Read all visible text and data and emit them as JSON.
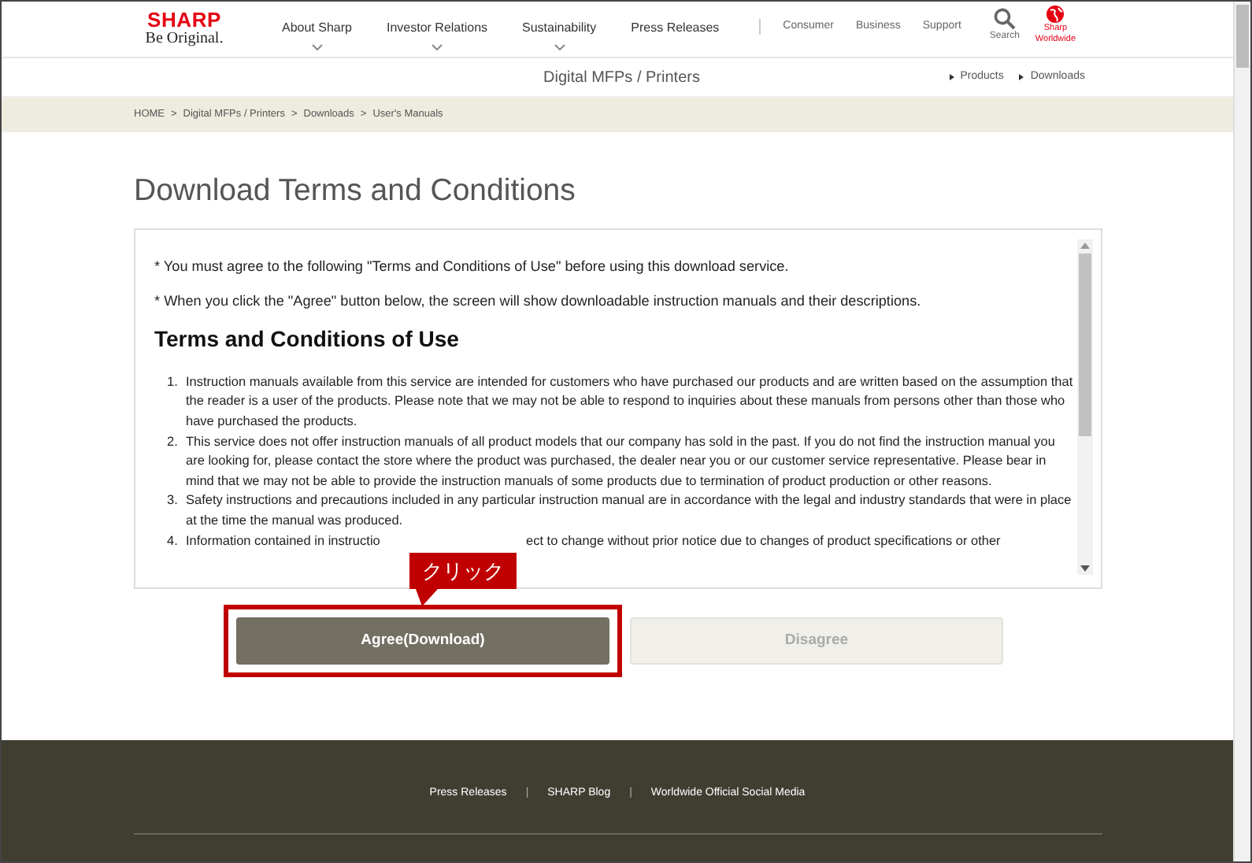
{
  "header": {
    "logo": "SHARP",
    "tagline": "Be Original.",
    "nav": [
      {
        "label": "About Sharp",
        "dropdown": true
      },
      {
        "label": "Investor Relations",
        "dropdown": true
      },
      {
        "label": "Sustainability",
        "dropdown": true
      },
      {
        "label": "Press Releases",
        "dropdown": false
      }
    ],
    "utility_links": [
      "Consumer",
      "Business",
      "Support"
    ],
    "search": "Search",
    "worldwide": [
      "Sharp",
      "Worldwide"
    ]
  },
  "subheader": {
    "title": "Digital MFPs / Printers",
    "links": [
      "Products",
      "Downloads"
    ]
  },
  "breadcrumb": [
    "HOME",
    "Digital MFPs / Printers",
    "Downloads",
    "User's Manuals"
  ],
  "breadcrumb_separator": ">",
  "page_title": "Download Terms and Conditions",
  "terms": {
    "notes": [
      "* You must agree to the following \"Terms and Conditions of Use\" before using this download service.",
      "* When you click the \"Agree\" button below, the screen will show downloadable instruction manuals and their descriptions."
    ],
    "heading": "Terms and Conditions of Use",
    "items": [
      {
        "number": "1.",
        "parts": [
          "Instruction manuals available from this service are intended for customers who have purchased our products and are written based on the assumption that the reader is a user of the products. Please note that we may not be able to respond to inquiries about these manuals from persons other than those who have purchased the products."
        ]
      },
      {
        "number": "2.",
        "parts": [
          "This service does not offer instruction manuals of all product models that our company has sold in the past. If you do not find the instruction manual you are looking for, please contact the store where the product was purchased, the dealer near you or our customer service representative. Please bear in mind that we may not be able to provide the instruction manuals of some products due to termination of product production or other reasons."
        ]
      },
      {
        "number": "3.",
        "parts": [
          "Safety instructions and precautions included in any particular instruction manual are in accordance with the legal and industry standards that were in place at the time the manual was produced."
        ]
      },
      {
        "number": "4.",
        "parts": [
          "Information contained in instructio",
          "ect to change without prior notice due to changes of product specifications or other"
        ]
      }
    ]
  },
  "buttons": [
    {
      "label": "Agree(Download)",
      "kind": "primary",
      "highlighted": true
    },
    {
      "label": "Disagree",
      "kind": "secondary",
      "highlighted": false
    }
  ],
  "callout": "クリック",
  "footer": {
    "links": [
      "Press Releases",
      "SHARP Blog",
      "Worldwide Official Social Media"
    ],
    "separator": "|"
  }
}
